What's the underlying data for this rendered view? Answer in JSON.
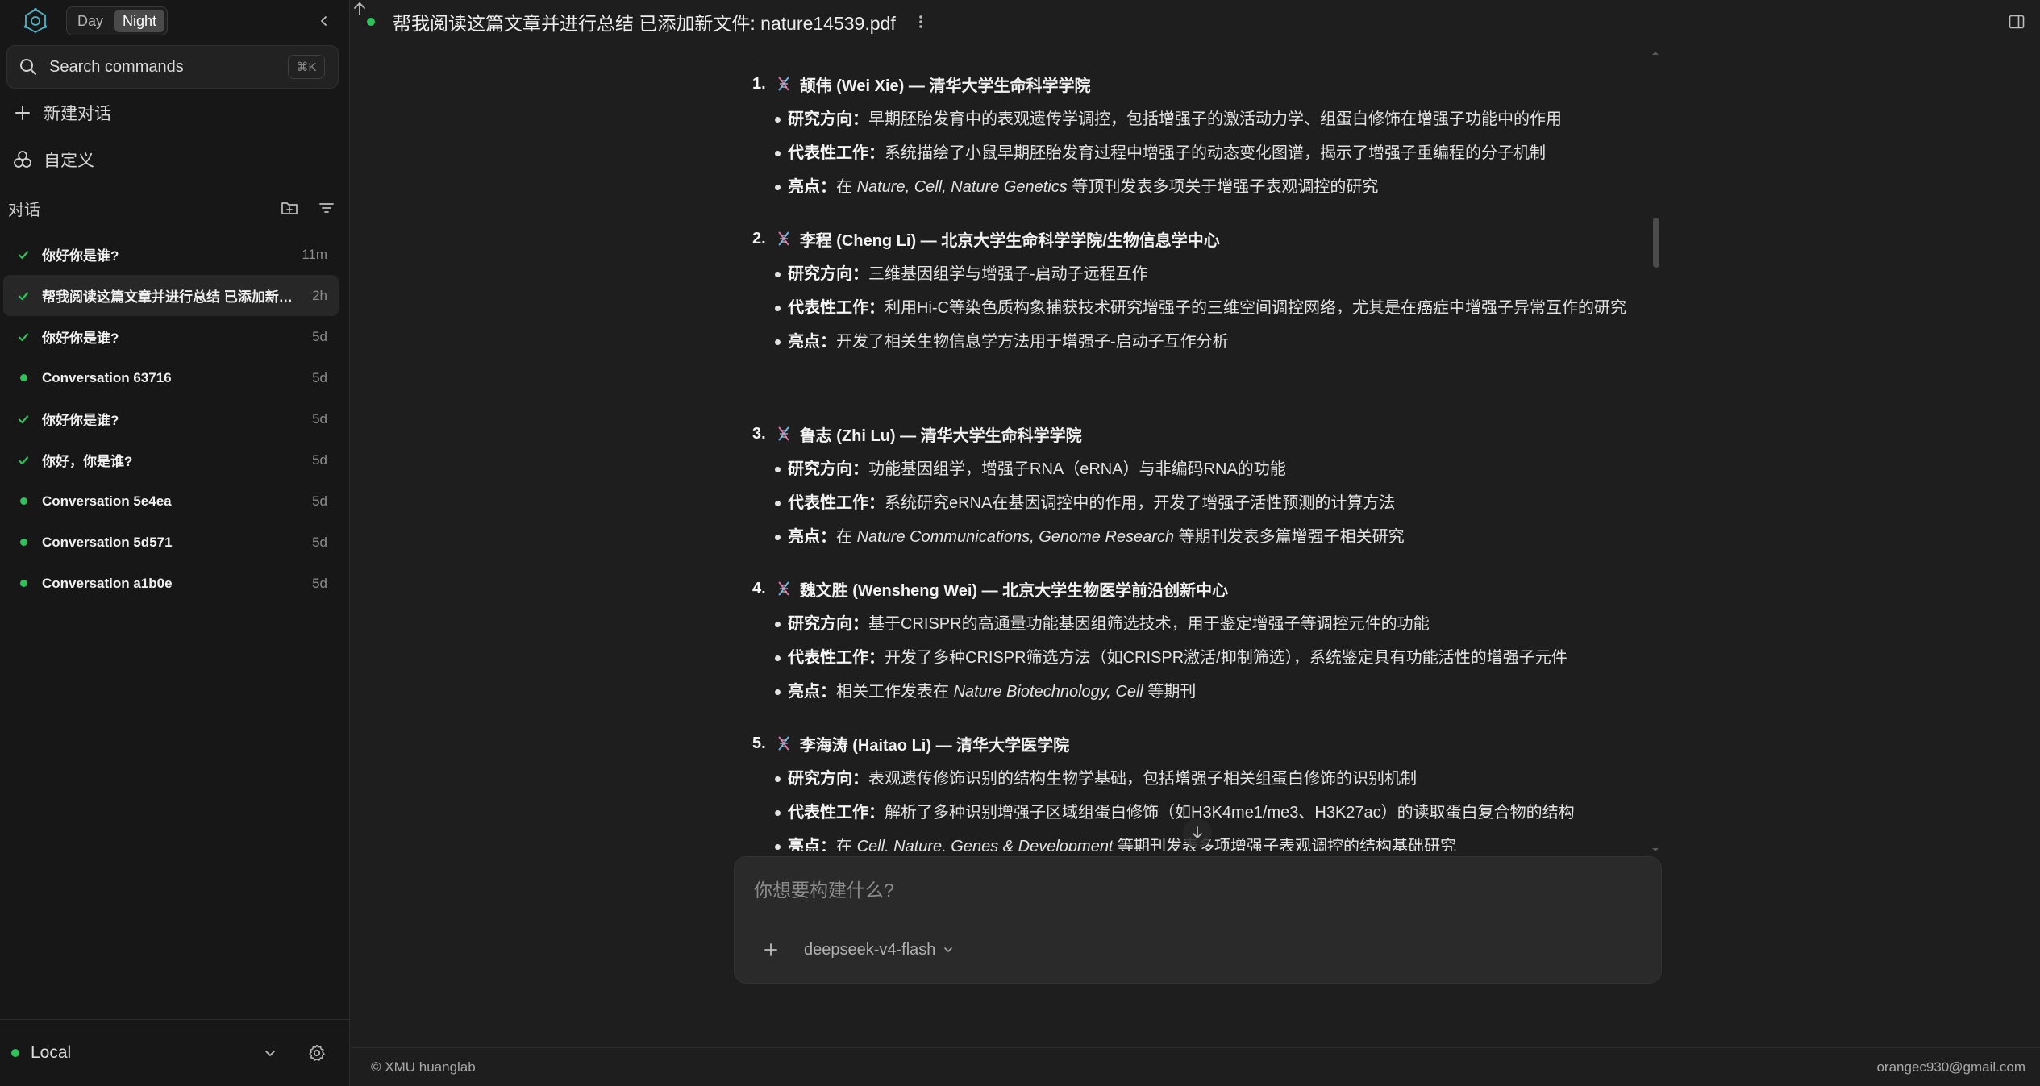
{
  "theme": {
    "options": [
      "Day",
      "Night"
    ],
    "active": "Night"
  },
  "search": {
    "label": "Search commands",
    "shortcut": "⌘K"
  },
  "sidebar": {
    "new_chat": "新建对话",
    "customize": "自定义",
    "section_title": "对话",
    "conversations": [
      {
        "title": "你好你是谁?",
        "time": "11m",
        "status": "check",
        "selected": false
      },
      {
        "title": "帮我阅读这篇文章并进行总结 已添加新文件: nature14539.pdf",
        "time": "2h",
        "status": "check",
        "selected": true
      },
      {
        "title": "你好你是谁?",
        "time": "5d",
        "status": "check",
        "selected": false
      },
      {
        "title": "Conversation 63716",
        "time": "5d",
        "status": "dot",
        "selected": false
      },
      {
        "title": "你好你是谁?",
        "time": "5d",
        "status": "check",
        "selected": false
      },
      {
        "title": "你好，你是谁?",
        "time": "5d",
        "status": "check",
        "selected": false
      },
      {
        "title": "Conversation 5e4ea",
        "time": "5d",
        "status": "dot",
        "selected": false
      },
      {
        "title": "Conversation 5d571",
        "time": "5d",
        "status": "dot",
        "selected": false
      },
      {
        "title": "Conversation a1b0e",
        "time": "5d",
        "status": "dot",
        "selected": false
      }
    ],
    "environment": "Local"
  },
  "header": {
    "title": "帮我阅读这篇文章并进行总结 已添加新文件: nature14539.pdf"
  },
  "message": {
    "entries": [
      {
        "number": "1.",
        "heading": "颉伟 (Wei Xie) — 清华大学生命科学学院",
        "bullets": [
          {
            "label": "研究方向",
            "parts": [
              {
                "t": "早期胚胎发育中的表观遗传学调控，包括增强子的激活动力学、组蛋白修饰在增强子功能中的作用"
              }
            ]
          },
          {
            "label": "代表性工作",
            "parts": [
              {
                "t": "系统描绘了小鼠早期胚胎发育过程中增强子的动态变化图谱，揭示了增强子重编程的分子机制"
              }
            ]
          },
          {
            "label": "亮点",
            "parts": [
              {
                "t": "在 "
              },
              {
                "t": "Nature, Cell, Nature Genetics",
                "i": true
              },
              {
                "t": " 等顶刊发表多项关于增强子表观调控的研究"
              }
            ]
          }
        ]
      },
      {
        "number": "2.",
        "heading": "李程 (Cheng Li) — 北京大学生命科学学院/生物信息学中心",
        "bullets": [
          {
            "label": "研究方向",
            "parts": [
              {
                "t": "三维基因组学与增强子-启动子远程互作"
              }
            ]
          },
          {
            "label": "代表性工作",
            "parts": [
              {
                "t": "利用Hi-C等染色质构象捕获技术研究增强子的三维空间调控网络，尤其是在癌症中增强子异常互作的研究"
              }
            ]
          },
          {
            "label": "亮点",
            "parts": [
              {
                "t": "开发了相关生物信息学方法用于增强子-启动子互作分析"
              }
            ]
          }
        ]
      },
      {
        "number": "3.",
        "heading": "鲁志 (Zhi Lu) — 清华大学生命科学学院",
        "bullets": [
          {
            "label": "研究方向",
            "parts": [
              {
                "t": "功能基因组学，增强子RNA（eRNA）与非编码RNA的功能"
              }
            ]
          },
          {
            "label": "代表性工作",
            "parts": [
              {
                "t": "系统研究eRNA在基因调控中的作用，开发了增强子活性预测的计算方法"
              }
            ]
          },
          {
            "label": "亮点",
            "parts": [
              {
                "t": "在 "
              },
              {
                "t": "Nature Communications, Genome Research",
                "i": true
              },
              {
                "t": " 等期刊发表多篇增强子相关研究"
              }
            ]
          }
        ]
      },
      {
        "number": "4.",
        "heading": "魏文胜 (Wensheng Wei) — 北京大学生物医学前沿创新中心",
        "bullets": [
          {
            "label": "研究方向",
            "parts": [
              {
                "t": "基于CRISPR的高通量功能基因组筛选技术，用于鉴定增强子等调控元件的功能"
              }
            ]
          },
          {
            "label": "代表性工作",
            "parts": [
              {
                "t": "开发了多种CRISPR筛选方法（如CRISPR激活/抑制筛选），系统鉴定具有功能活性的增强子元件"
              }
            ]
          },
          {
            "label": "亮点",
            "parts": [
              {
                "t": "相关工作发表在 "
              },
              {
                "t": "Nature Biotechnology, Cell",
                "i": true
              },
              {
                "t": " 等期刊"
              }
            ]
          }
        ]
      },
      {
        "number": "5.",
        "heading": "李海涛 (Haitao Li) — 清华大学医学院",
        "bullets": [
          {
            "label": "研究方向",
            "parts": [
              {
                "t": "表观遗传修饰识别的结构生物学基础，包括增强子相关组蛋白修饰的识别机制"
              }
            ]
          },
          {
            "label": "代表性工作",
            "parts": [
              {
                "t": "解析了多种识别增强子区域组蛋白修饰（如H3K4me1/me3、H3K27ac）的读取蛋白复合物的结构"
              }
            ]
          },
          {
            "label": "亮点",
            "parts": [
              {
                "t": "在 "
              },
              {
                "t": "Cell, Nature, Genes & Development",
                "i": true
              },
              {
                "t": " 等期刊发表多项增强子表观调控的结构基础研究"
              }
            ]
          }
        ]
      }
    ]
  },
  "composer": {
    "placeholder": "你想要构建什么?",
    "model": "deepseek-v4-flash"
  },
  "footer": {
    "left": "© XMU huanglab",
    "right": "orangec930@gmail.com"
  },
  "colors": {
    "accent_green": "#2fc25b",
    "background": "#1e1e1e",
    "sidebar": "#171717"
  }
}
